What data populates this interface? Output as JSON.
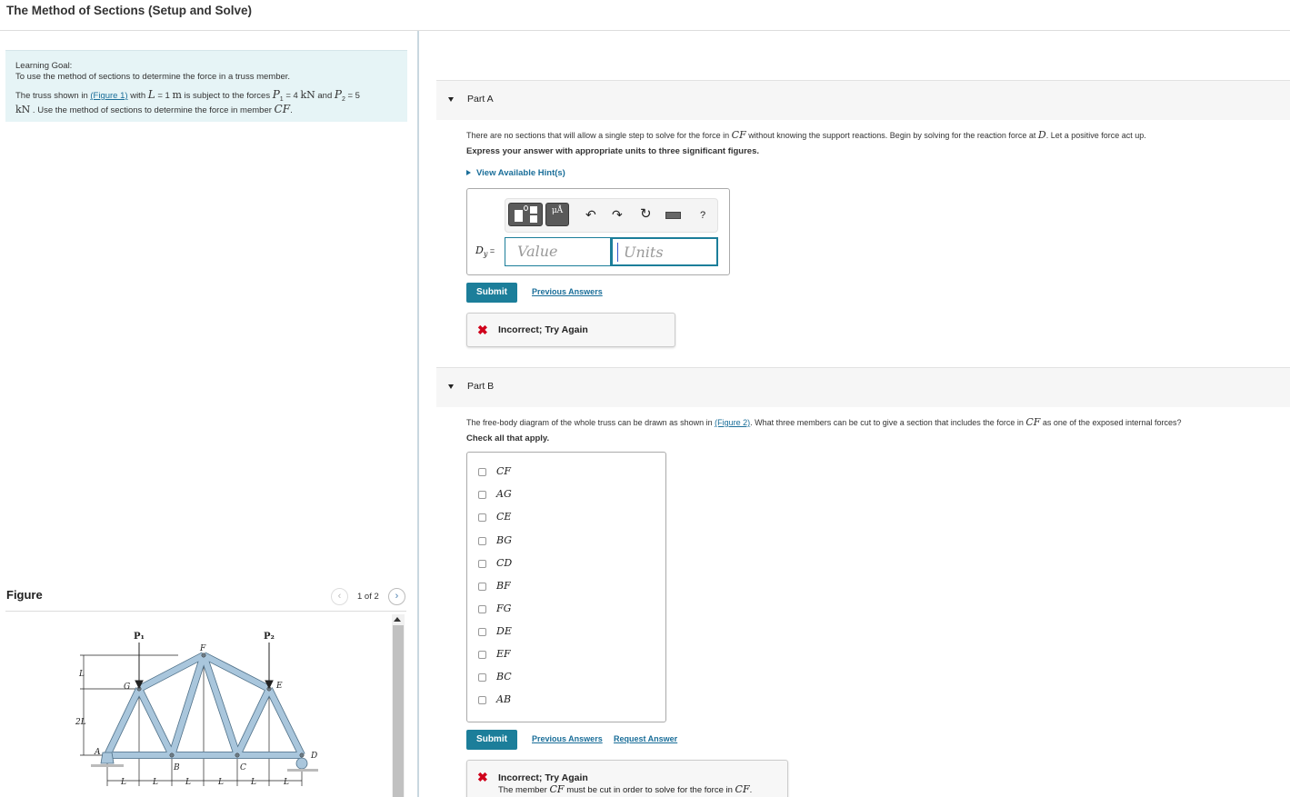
{
  "page": {
    "title": "The Method of Sections (Setup and Solve)"
  },
  "goal": {
    "title": "Learning Goal:",
    "description": "To use the method of sections to determine the force in a truss member.",
    "p_prefix": "The truss shown in ",
    "figure_link": "(Figure 1)",
    "p_with": " with ",
    "L_sym": "L",
    "L_eq": " = 1 ",
    "L_unit": "m",
    "p_mid": " is subject to the forces ",
    "P1_sym": "P",
    "P1_sub": "1",
    "P1_eq": " = 4 ",
    "P1_unit": "kN",
    "p_and": " and ",
    "P2_sym": "P",
    "P2_sub": "2",
    "P2_eq": " = 5",
    "P2_unit": "kN",
    "p_suffix": " . Use the method of sections to determine the force in member ",
    "member": "CF",
    "p_end": "."
  },
  "figure": {
    "label": "Figure",
    "counter": "1 of 2",
    "prev_icon": "chevron-left",
    "next_icon": "chevron-right",
    "labels": {
      "P1": "P₁",
      "P2": "P₂",
      "F": "F",
      "G": "G",
      "E": "E",
      "A": "A",
      "B": "B",
      "C": "C",
      "D": "D",
      "L": "L",
      "two_L": "2L"
    },
    "colors": {
      "member": "#a9c6dc",
      "member_edge": "#4e6f87"
    }
  },
  "partA": {
    "label": "Part A",
    "text_prefix": "There are no sections that will allow a single step to solve for the force in ",
    "text_member": "CF",
    "text_mid": " without knowing the support reactions. Begin by solving for the reaction force at ",
    "text_point": "D",
    "text_suffix": ". Let a positive force act up.",
    "instruction": "Express your answer with appropriate units to three significant figures.",
    "hints_label": "View Available Hint(s)",
    "toolbar": {
      "templates_icon": "templates",
      "units_label": "μÅ",
      "undo_icon": "↶",
      "redo_icon": "↷",
      "reset_icon": "↻",
      "keyboard_icon": "keyboard",
      "help_label": "?"
    },
    "answer_label_sym": "D",
    "answer_label_sub": "y",
    "answer_label_eq": " =",
    "value_placeholder": "Value",
    "units_placeholder": "Units",
    "submit_label": "Submit",
    "previous_answers_label": "Previous Answers",
    "feedback": {
      "icon": "✖",
      "title": "Incorrect; Try Again"
    }
  },
  "partB": {
    "label": "Part B",
    "text_prefix": "The free-body diagram of the whole truss can be drawn as shown in ",
    "figure_link": "(Figure 2)",
    "text_mid": ". What three members can be cut to give a section that includes the force in ",
    "text_member": "CF",
    "text_suffix": " as one of the exposed internal forces?",
    "instruction": "Check all that apply.",
    "options": [
      {
        "label": "CF",
        "checked": false
      },
      {
        "label": "AG",
        "checked": false
      },
      {
        "label": "CE",
        "checked": false
      },
      {
        "label": "BG",
        "checked": false
      },
      {
        "label": "CD",
        "checked": false
      },
      {
        "label": "BF",
        "checked": false
      },
      {
        "label": "FG",
        "checked": false
      },
      {
        "label": "DE",
        "checked": false
      },
      {
        "label": "EF",
        "checked": false
      },
      {
        "label": "BC",
        "checked": false
      },
      {
        "label": "AB",
        "checked": false
      }
    ],
    "submit_label": "Submit",
    "previous_answers_label": "Previous Answers",
    "request_answer_label": "Request Answer",
    "feedback": {
      "icon": "✖",
      "title": "Incorrect; Try Again",
      "msg_prefix": "The member ",
      "msg_member": "CF",
      "msg_mid": " must be cut in order to solve for the force in ",
      "msg_member2": "CF",
      "msg_end": "."
    }
  }
}
